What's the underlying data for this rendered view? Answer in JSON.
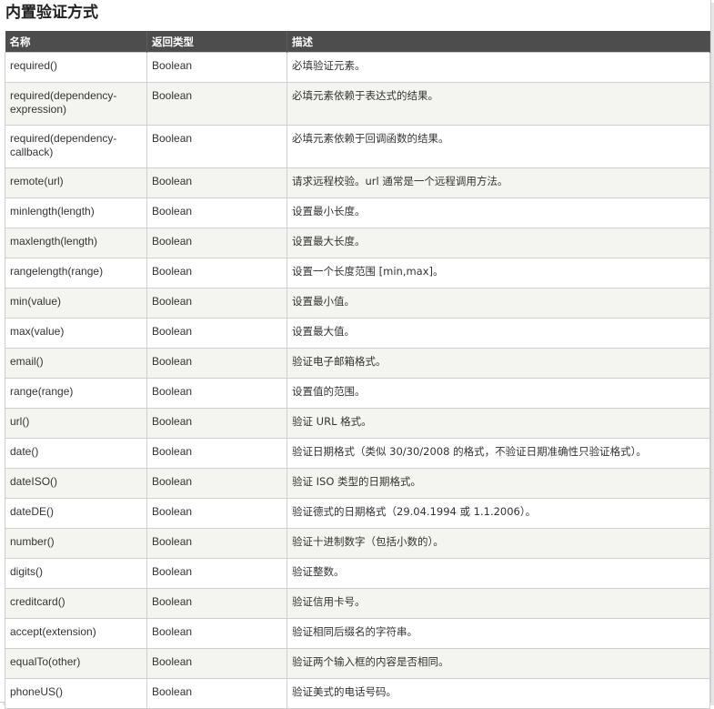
{
  "title": "内置验证方式",
  "headers": [
    "名称",
    "返回类型",
    "描述"
  ],
  "rows": [
    {
      "name": "required()",
      "type": "Boolean",
      "desc": "必填验证元素。"
    },
    {
      "name": "required(dependency-expression)",
      "type": "Boolean",
      "desc": "必填元素依赖于表达式的结果。"
    },
    {
      "name": "required(dependency-callback)",
      "type": "Boolean",
      "desc": "必填元素依赖于回调函数的结果。"
    },
    {
      "name": "remote(url)",
      "type": "Boolean",
      "desc": "请求远程校验。url 通常是一个远程调用方法。"
    },
    {
      "name": "minlength(length)",
      "type": "Boolean",
      "desc": "设置最小长度。"
    },
    {
      "name": "maxlength(length)",
      "type": "Boolean",
      "desc": "设置最大长度。"
    },
    {
      "name": "rangelength(range)",
      "type": "Boolean",
      "desc": "设置一个长度范围 [min,max]。"
    },
    {
      "name": "min(value)",
      "type": "Boolean",
      "desc": "设置最小值。"
    },
    {
      "name": "max(value)",
      "type": "Boolean",
      "desc": "设置最大值。"
    },
    {
      "name": "email()",
      "type": "Boolean",
      "desc": "验证电子邮箱格式。"
    },
    {
      "name": "range(range)",
      "type": "Boolean",
      "desc": "设置值的范围。"
    },
    {
      "name": "url()",
      "type": "Boolean",
      "desc": "验证 URL 格式。"
    },
    {
      "name": "date()",
      "type": "Boolean",
      "desc": "验证日期格式（类似 30/30/2008 的格式，不验证日期准确性只验证格式）。"
    },
    {
      "name": "dateISO()",
      "type": "Boolean",
      "desc": "验证 ISO 类型的日期格式。"
    },
    {
      "name": "dateDE()",
      "type": "Boolean",
      "desc": "验证德式的日期格式（29.04.1994 或 1.1.2006）。"
    },
    {
      "name": "number()",
      "type": "Boolean",
      "desc": "验证十进制数字（包括小数的）。"
    },
    {
      "name": "digits()",
      "type": "Boolean",
      "desc": "验证整数。"
    },
    {
      "name": "creditcard()",
      "type": "Boolean",
      "desc": "验证信用卡号。"
    },
    {
      "name": "accept(extension)",
      "type": "Boolean",
      "desc": "验证相同后缀名的字符串。"
    },
    {
      "name": "equalTo(other)",
      "type": "Boolean",
      "desc": "验证两个输入框的内容是否相同。"
    },
    {
      "name": "phoneUS()",
      "type": "Boolean",
      "desc": "验证美式的电话号码。"
    }
  ]
}
